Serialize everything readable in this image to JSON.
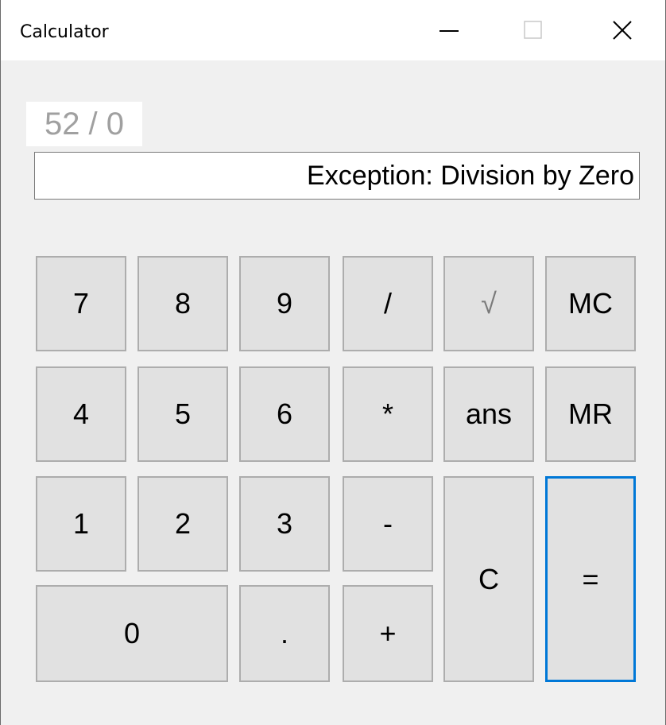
{
  "window": {
    "title": "Calculator"
  },
  "titlebar_icons": [
    "minimize-icon",
    "maximize-icon",
    "close-icon"
  ],
  "display": {
    "expression": "52 / 0",
    "result": "Exception: Division by Zero"
  },
  "keys": {
    "k7": "7",
    "k8": "8",
    "k9": "9",
    "div": "/",
    "sqrt": "√",
    "mc": "MC",
    "k4": "4",
    "k5": "5",
    "k6": "6",
    "mul": "*",
    "ans": "ans",
    "mr": "MR",
    "k1": "1",
    "k2": "2",
    "k3": "3",
    "sub": "-",
    "clear": "C",
    "eq": "=",
    "k0": "0",
    "dot": ".",
    "add": "+"
  },
  "colors": {
    "accent": "#0078d7",
    "button_face": "#e1e1e1",
    "background": "#f0f0f0"
  }
}
